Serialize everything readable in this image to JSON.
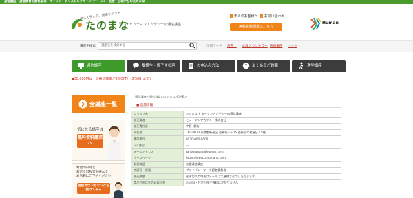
{
  "topbar": {
    "text": "通信講座・通信教育で資格取得、キャリア・クリスタルグループ デー→dd・医療・心理学びのたのまな"
  },
  "header": {
    "tagline": "楽しく学んで、資格をゲット",
    "logo_text": "たのまな",
    "logo_sub": "ヒューマンアカデミーの通信講座",
    "links": [
      "法人のお客様へ",
      "お問い合わせ"
    ],
    "cta": "無料資料請求はこちら",
    "brand": "Human"
  },
  "search": {
    "label": "講座を検索",
    "placeholder": "講座名を検索する",
    "kw_label": "注目ワード",
    "keywords": [
      "保育士",
      "心理カウンセラー",
      "医療事務",
      "ペット"
    ]
  },
  "nav": [
    {
      "label": "通信講座"
    },
    {
      "label": "受講生・修了生の声"
    },
    {
      "label": "お申込み方法"
    },
    {
      "label": "よくあるご質問"
    },
    {
      "label": "通学講座"
    }
  ],
  "notice": "◆30,000円以上の通信講座が3%OFF！(3/3(日)まで)",
  "sidebar": {
    "all_courses": "全講座一覧",
    "card1": {
      "head": "気になる講座は",
      "button": "無料資料請求へ"
    },
    "card2": {
      "lines": [
        "希望の日時と",
        "お近くの校舎を選んで",
        "お気軽にご予約ください！"
      ],
      "button": "個別カウンセリングを受けてみる"
    }
  },
  "main": {
    "breadcrumb": "通信講座・通信教育のたのまなHOME＞",
    "section_title": "■ 店舗情報",
    "rows": [
      {
        "k": "ショップ名",
        "v": "たのまな ヒューマンアカデミーの通信講座"
      },
      {
        "k": "販売業者",
        "v": "ヒューマンアカデミー株式会社"
      },
      {
        "k": "販売責任者",
        "v": "宇野 (顧有)"
      },
      {
        "k": "所在地",
        "v": "160-0023 東京都新宿区 西新宿7-5-25 西新宿木村屋ビル5階"
      },
      {
        "k": "電話番号",
        "v": "0120-000-0000"
      },
      {
        "k": "FAX番号",
        "v": "---"
      },
      {
        "k": "メールアドレス",
        "v": "tanomana@athuman.com"
      },
      {
        "k": "ホームページ",
        "v": "https://www.tanomana.com/"
      },
      {
        "k": "取扱商品",
        "v": "各種通信講座"
      },
      {
        "k": "許認可・資格",
        "v": "プライバシーマーク認定事業者"
      },
      {
        "k": "販売数量",
        "v": "在庫切れの場合はメールにて連絡させていただきます。"
      },
      {
        "k": "商品代金以外の必要料金",
        "v": "◎ 送料・代金引換手数料はかかりません"
      }
    ]
  },
  "colors": {
    "green": "#3f9a2c",
    "orange": "#f08419",
    "red": "#c0392b",
    "dark": "#3c3c3c"
  }
}
